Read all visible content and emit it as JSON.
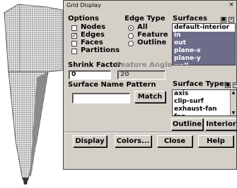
{
  "window": {
    "title": "Grid Display",
    "close_glyph": "×"
  },
  "options": {
    "label": "Options",
    "items": [
      {
        "label": "Nodes",
        "checked": false
      },
      {
        "label": "Edges",
        "checked": true,
        "mark": "✓"
      },
      {
        "label": "Faces",
        "checked": false
      },
      {
        "label": "Partitions",
        "checked": false
      }
    ]
  },
  "edge_type": {
    "label": "Edge Type",
    "items": [
      {
        "label": "All",
        "selected": true
      },
      {
        "label": "Feature",
        "selected": false
      },
      {
        "label": "Outline",
        "selected": false
      }
    ]
  },
  "surfaces": {
    "label": "Surfaces",
    "items": [
      {
        "label": "default-interior",
        "selected": false
      },
      {
        "label": "in",
        "selected": true
      },
      {
        "label": "out",
        "selected": true
      },
      {
        "label": "plane-x",
        "selected": true
      },
      {
        "label": "plane-y",
        "selected": true
      },
      {
        "label": "wall",
        "selected": true
      }
    ]
  },
  "shrink_factor": {
    "label": "Shrink Factor",
    "value": "0"
  },
  "feature_angle": {
    "label": "Feature Angle",
    "value": "20"
  },
  "surface_name_pattern": {
    "label": "Surface Name Pattern",
    "value": "",
    "match_label": "Match"
  },
  "surface_types": {
    "label": "Surface Types",
    "items": [
      "axis",
      "clip-surf",
      "exhaust-fan",
      "fan"
    ]
  },
  "surface_buttons": {
    "outline": "Outline",
    "interior": "Interior"
  },
  "bottom_buttons": {
    "display": "Display",
    "colors": "Colors...",
    "close": "Close",
    "help": "Help"
  },
  "colors": {
    "dialog_bg": "#d4d0c8",
    "selection": "#6d6d8a"
  }
}
